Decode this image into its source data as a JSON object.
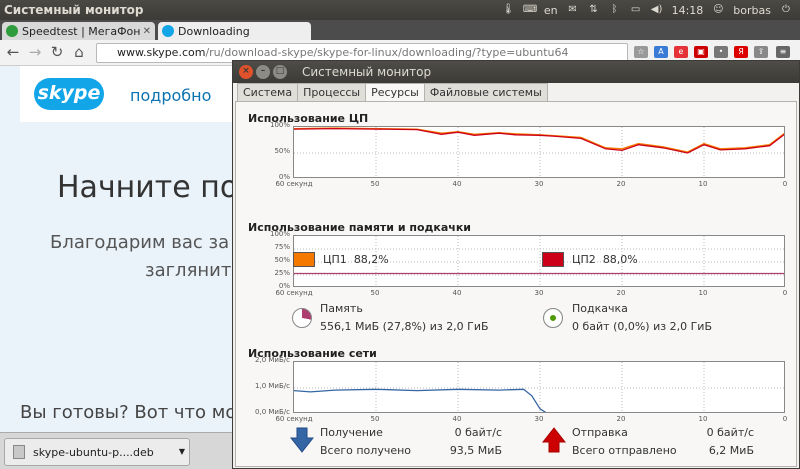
{
  "topbar": {
    "title": "Системный монитор",
    "kbd": "en",
    "time": "14:18",
    "user": "borbas"
  },
  "browser": {
    "tabs": [
      {
        "label": "Speedtest | МегаФон"
      },
      {
        "label": "Downloading"
      }
    ],
    "url_domain": "www.skype.com",
    "url_path": "/ru/download-skype/skype-for-linux/downloading/?type=ubuntu64",
    "page": {
      "logo": "skype",
      "nav_link": "подробно",
      "heading": "Начните пол",
      "para1": "Благодарим вас за",
      "para2": "загляните",
      "ready": "Вы готовы? Вот что мо"
    },
    "download": {
      "file": "skype-ubuntu-p....deb"
    }
  },
  "sysmon": {
    "title": "Системный монитор",
    "tabs": [
      "Система",
      "Процессы",
      "Ресурсы",
      "Файловые системы"
    ],
    "active_tab": "Ресурсы",
    "xticks": [
      "60 секунд",
      "50",
      "40",
      "30",
      "20",
      "10",
      "0"
    ],
    "cpu": {
      "heading": "Использование ЦП",
      "yticks": [
        "100%",
        "50%",
        "0%"
      ],
      "cpu1_label": "ЦП1",
      "cpu1_value": "88,2%",
      "cpu1_color": "#f57900",
      "cpu2_label": "ЦП2",
      "cpu2_value": "88,0%",
      "cpu2_color": "#cc0018"
    },
    "mem": {
      "heading": "Использование памяти и подкачки",
      "yticks": [
        "100%",
        "75%",
        "50%",
        "25%",
        "0%"
      ],
      "mem_label": "Память",
      "mem_value": "556,1 МиБ (27,8%) из 2,0 ГиБ",
      "mem_color": "#ad3d6e",
      "swap_label": "Подкачка",
      "swap_value": "0 байт (0,0%) из 2,0 ГиБ",
      "swap_color": "#4e9a06"
    },
    "net": {
      "heading": "Использование сети",
      "yticks": [
        "2,0 МиБ/с",
        "1,0 МиБ/с",
        "0,0 МиБ/с"
      ],
      "recv_label": "Получение",
      "recv_rate": "0 байт/с",
      "recv_total_label": "Всего получено",
      "recv_total": "93,5 МиБ",
      "recv_color": "#3465a4",
      "send_label": "Отправка",
      "send_rate": "0 байт/с",
      "send_total_label": "Всего отправлено",
      "send_total": "6,2 МиБ",
      "send_color": "#cc0000"
    }
  },
  "chart_data": [
    {
      "type": "line",
      "title": "Использование ЦП",
      "x": [
        60,
        55,
        50,
        45,
        42,
        40,
        38,
        35,
        33,
        30,
        28,
        25,
        22,
        20,
        18,
        15,
        12,
        10,
        8,
        5,
        2,
        0
      ],
      "xlim": [
        60,
        0
      ],
      "ylim": [
        0,
        100
      ],
      "series": [
        {
          "name": "ЦП1",
          "values": [
            97,
            98,
            97,
            96,
            88,
            91,
            86,
            89,
            87,
            85,
            83,
            80,
            60,
            58,
            68,
            62,
            52,
            68,
            58,
            60,
            66,
            90
          ]
        },
        {
          "name": "ЦП2",
          "values": [
            96,
            97,
            96,
            95,
            86,
            90,
            84,
            88,
            85,
            84,
            82,
            78,
            58,
            55,
            66,
            60,
            50,
            66,
            56,
            58,
            64,
            88
          ]
        }
      ]
    },
    {
      "type": "line",
      "title": "Использование памяти и подкачки",
      "x": [
        60,
        0
      ],
      "xlim": [
        60,
        0
      ],
      "ylim": [
        0,
        100
      ],
      "series": [
        {
          "name": "Память",
          "values": [
            27.8,
            27.8
          ]
        },
        {
          "name": "Подкачка",
          "values": [
            0,
            0
          ]
        }
      ]
    },
    {
      "type": "line",
      "title": "Использование сети",
      "x": [
        60,
        58,
        55,
        50,
        45,
        40,
        35,
        32,
        31,
        30,
        29,
        0
      ],
      "xlim": [
        60,
        0
      ],
      "ylim": [
        0,
        2
      ],
      "series": [
        {
          "name": "Получение",
          "values": [
            0.9,
            0.85,
            0.92,
            0.95,
            0.9,
            0.95,
            0.92,
            0.95,
            0.7,
            0.2,
            0,
            0
          ]
        },
        {
          "name": "Отправка",
          "values": [
            0.03,
            0.03,
            0.03,
            0.03,
            0.03,
            0.03,
            0.03,
            0.03,
            0.03,
            0.01,
            0,
            0
          ]
        }
      ]
    }
  ]
}
